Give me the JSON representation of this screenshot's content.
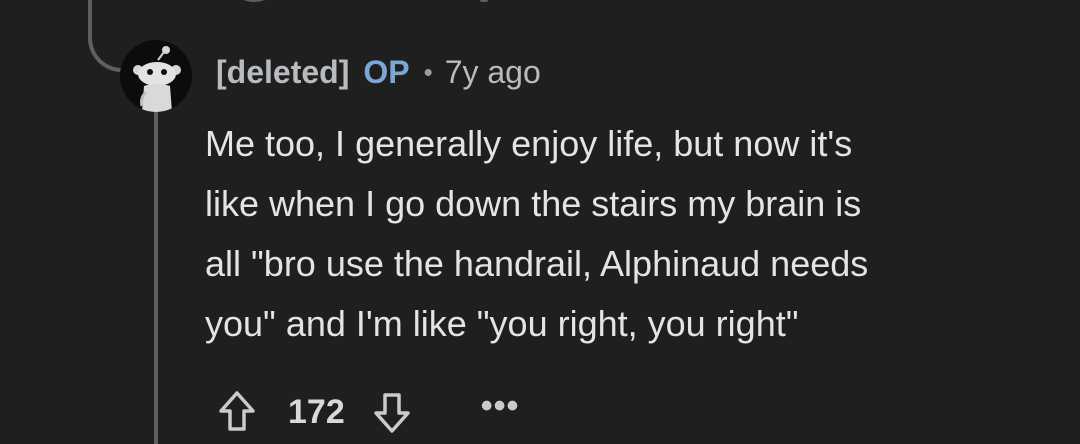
{
  "comment": {
    "author": "[deleted]",
    "op_badge": "OP",
    "separator": "•",
    "timestamp": "7y ago",
    "body_lines": [
      "Me too, I generally enjoy life, but now it's",
      "like when I go down the stairs my brain is",
      "all \"bro use the handrail, Alphinaud needs",
      "you\" and I'm like \"you right, you right\""
    ],
    "score": "172",
    "more_label": "•••"
  },
  "icons": {
    "avatar": "snoo-avatar-icon",
    "upvote": "upvote-arrow-icon",
    "downvote": "downvote-arrow-icon",
    "more": "more-options-icon"
  },
  "colors": {
    "background": "#1f1f1f",
    "op_badge": "#7ba7d8",
    "text": "#e2e4e6",
    "thread_line": "#5f5f5f"
  }
}
